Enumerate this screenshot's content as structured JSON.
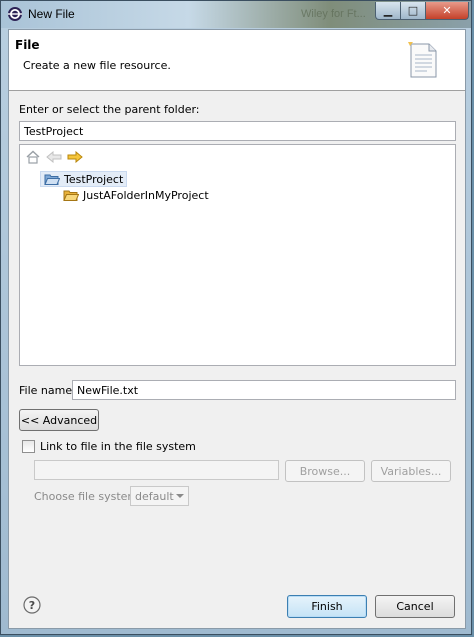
{
  "window": {
    "title": "New File",
    "background_ghost_text": "Wiley for Ft..."
  },
  "banner": {
    "title": "File",
    "description": "Create a new file resource."
  },
  "parent_folder": {
    "label": "Enter or select the parent folder:",
    "value": "TestProject"
  },
  "tree": {
    "items": [
      {
        "label": "TestProject",
        "selected": true
      },
      {
        "label": "JustAFolderInMyProject",
        "selected": false
      }
    ]
  },
  "file_name": {
    "label": "File name:",
    "value": "NewFile.txt"
  },
  "advanced_button": "<< Advanced",
  "link": {
    "checkbox_label": "Link to file in the file system",
    "checked": false,
    "location_value": "",
    "browse_button": "Browse...",
    "variables_button": "Variables...",
    "choose_fs_label": "Choose file system:",
    "fs_value": "default"
  },
  "footer": {
    "finish_button": "Finish",
    "cancel_button": "Cancel"
  },
  "colors": {
    "accent": "#3c7fb1",
    "close": "#c4412a",
    "folder": "#e8b13a"
  }
}
